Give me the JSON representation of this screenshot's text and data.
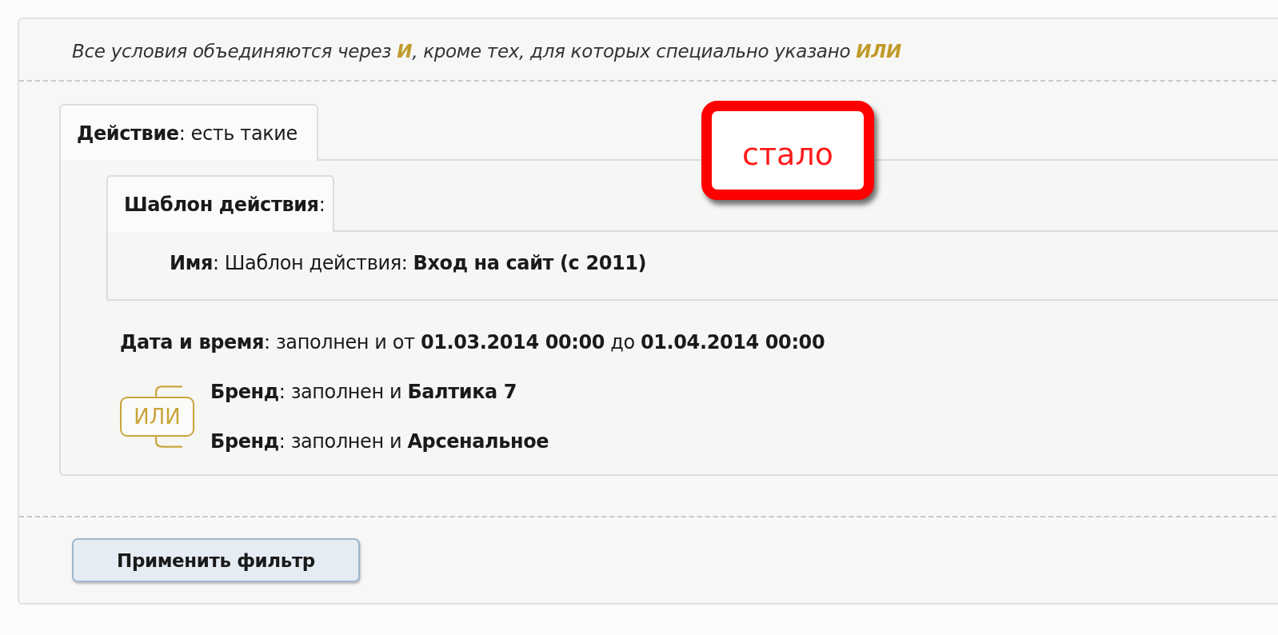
{
  "note": "Все условия объединяются через **И**, кроме тех, для которых специально указано **ИЛИ**",
  "group": {
    "tab": "**Действие**: есть такие",
    "subgroup": {
      "tab": "**Шаблон действия**:",
      "conditions": [
        "**Имя**: Шаблон действия: **Вход на сайт (с 2011)**"
      ]
    },
    "conditions": [
      "**Дата и время**: заполнен и от **01.03.2014 00:00** до **01.04.2014 00:00**"
    ],
    "or_group": {
      "badge": "ИЛИ",
      "conditions": [
        "**Бренд**: заполнен и **Балтика 7**",
        "**Бренд**: заполнен и **Арсенальное**"
      ]
    }
  },
  "annotation": {
    "text": "стало"
  },
  "buttons": [
    "Применить фильтр"
  ]
}
